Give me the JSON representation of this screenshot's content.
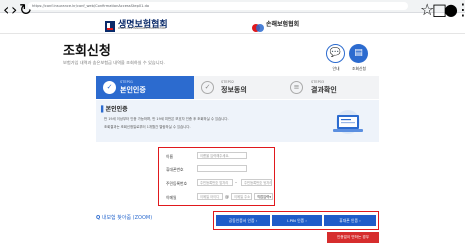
{
  "browser": {
    "url": "https://conf.insurance.kr/conf_web/ConfirmationAccessStep01.do"
  },
  "header": {
    "logo1_title": "생명보험협회",
    "logo1_sub": "KOREA LIFE INSURANCE ASSOCIATION",
    "logo2_title": "손해보험협회"
  },
  "page": {
    "title": "조회신청",
    "subtitle": "보험가입 내역과 숨은보험금 내역을 조회하실 수 있습니다.",
    "guide_label": "안내",
    "history_label": "조회신청"
  },
  "steps": [
    {
      "num": "STEP01",
      "name": "본인인증"
    },
    {
      "num": "STEP02",
      "name": "정보동의"
    },
    {
      "num": "STEP03",
      "name": "결과확인"
    }
  ],
  "auth": {
    "title": "본인인증",
    "bullets": [
      "만 19세 이상부터 인증 가능하며, 만 19세 미만은 보호자 인증 후 조회하실 수 있습니다.",
      "조회결과는 조회신청일로부터 1개월간 열람하실 수 있습니다."
    ]
  },
  "form": {
    "name_label": "이름",
    "name_placeholder": "이름을 입력해주세요.",
    "phone_label": "휴대폰번호",
    "rrn_label": "주민등록번호",
    "rrn_front_placeholder": "주민등록번호 앞자리",
    "rrn_back_placeholder": "주민등록번호 뒷자리",
    "email_label": "이메일",
    "email_id_placeholder": "이메일 아이디",
    "email_domain_placeholder": "이메일 주소",
    "email_select": "직접입력"
  },
  "zoom_label": "내보험 찾아줌 (ZOOM)",
  "buttons": {
    "cert": "공동인증서 인증",
    "ipin": "I-PIN 인증",
    "phone": "휴대폰 인증",
    "nocert": "인증없이 만하는 경우"
  },
  "colors": {
    "primary": "#2c6bcf",
    "highlight": "#e0191d",
    "button": "#1f5cc9"
  }
}
